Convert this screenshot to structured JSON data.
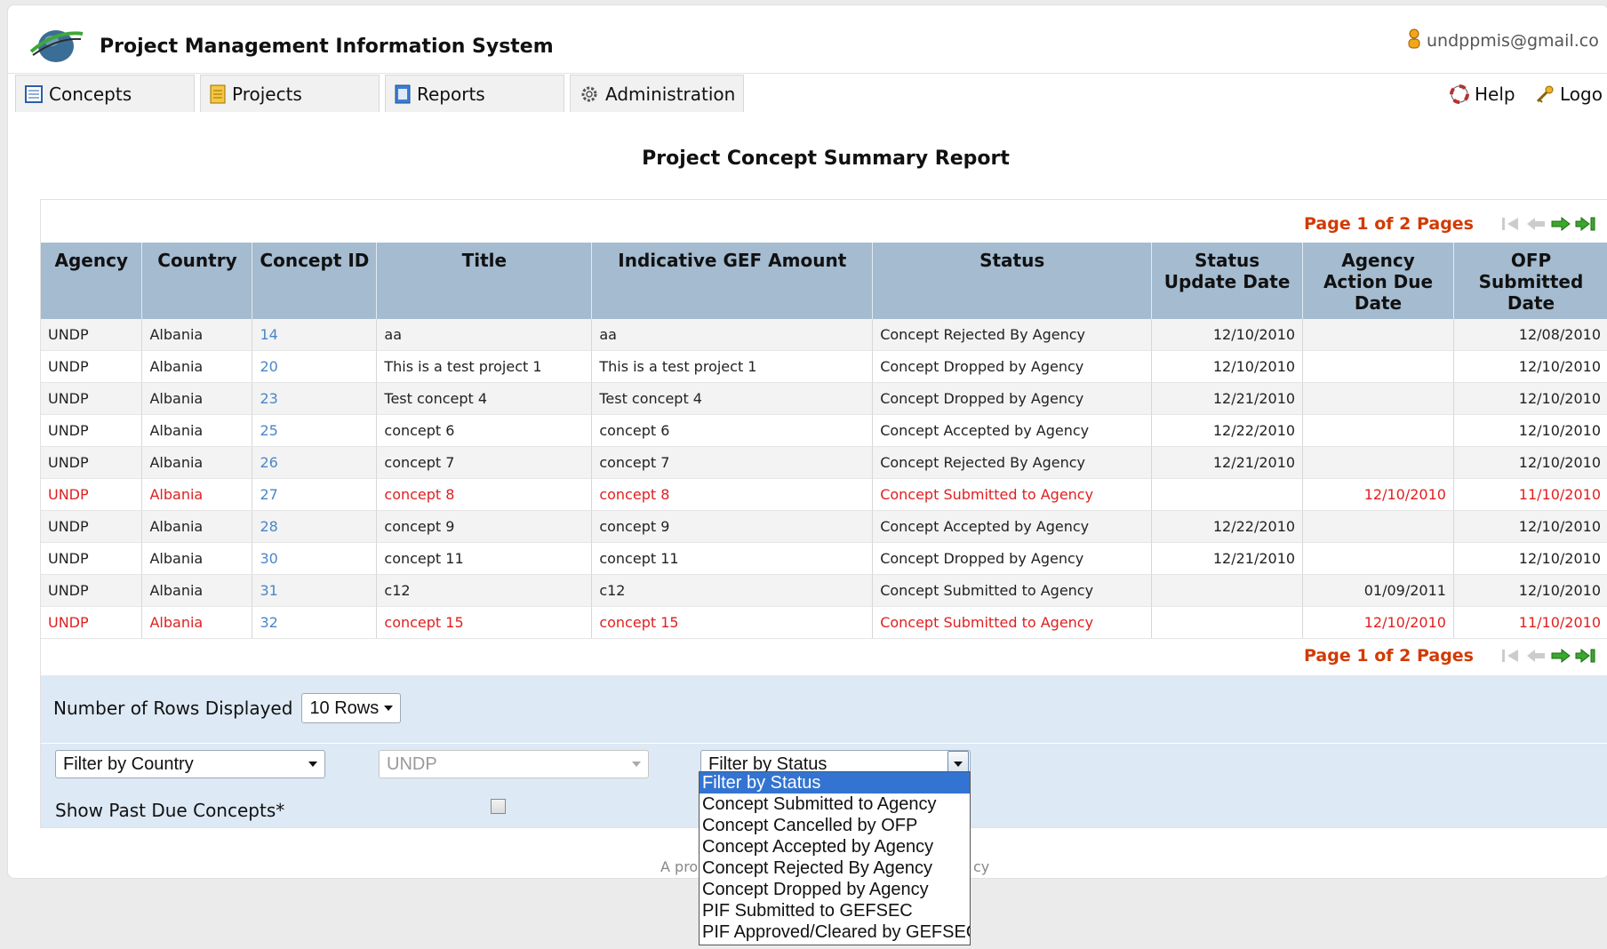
{
  "header": {
    "app_title": "Project Management Information System",
    "user_email": "undppmis@gmail.co"
  },
  "tabs": [
    {
      "label": "Concepts",
      "icon": "list-icon"
    },
    {
      "label": "Projects",
      "icon": "document-icon"
    },
    {
      "label": "Reports",
      "icon": "report-icon"
    },
    {
      "label": "Administration",
      "icon": "gear-icon"
    }
  ],
  "top_links": {
    "help": "Help",
    "logout": "Logo"
  },
  "report": {
    "title": "Project Concept Summary Report",
    "pager_text": "Page 1 of 2 Pages",
    "columns": [
      "Agency",
      "Country",
      "Concept ID",
      "Title",
      "Indicative GEF Amount",
      "Status",
      "Status Update Date",
      "Agency Action Due Date",
      "OFP Submitted Date"
    ],
    "rows": [
      {
        "agency": "UNDP",
        "country": "Albania",
        "id": "14",
        "title": "aa",
        "amount": "aa",
        "status": "Concept Rejected By Agency",
        "status_date": "12/10/2010",
        "due_date": "",
        "ofp_date": "12/08/2010",
        "overdue": false
      },
      {
        "agency": "UNDP",
        "country": "Albania",
        "id": "20",
        "title": "This is a test project 1",
        "amount": "This is a test project 1",
        "status": "Concept Dropped by Agency",
        "status_date": "12/10/2010",
        "due_date": "",
        "ofp_date": "12/10/2010",
        "overdue": false
      },
      {
        "agency": "UNDP",
        "country": "Albania",
        "id": "23",
        "title": "Test concept 4",
        "amount": "Test concept 4",
        "status": "Concept Dropped by Agency",
        "status_date": "12/21/2010",
        "due_date": "",
        "ofp_date": "12/10/2010",
        "overdue": false
      },
      {
        "agency": "UNDP",
        "country": "Albania",
        "id": "25",
        "title": "concept 6",
        "amount": "concept 6",
        "status": "Concept Accepted by Agency",
        "status_date": "12/22/2010",
        "due_date": "",
        "ofp_date": "12/10/2010",
        "overdue": false
      },
      {
        "agency": "UNDP",
        "country": "Albania",
        "id": "26",
        "title": "concept 7",
        "amount": "concept 7",
        "status": "Concept Rejected By Agency",
        "status_date": "12/21/2010",
        "due_date": "",
        "ofp_date": "12/10/2010",
        "overdue": false
      },
      {
        "agency": "UNDP",
        "country": "Albania",
        "id": "27",
        "title": "concept 8",
        "amount": "concept 8",
        "status": "Concept Submitted to Agency",
        "status_date": "",
        "due_date": "12/10/2010",
        "ofp_date": "11/10/2010",
        "overdue": true
      },
      {
        "agency": "UNDP",
        "country": "Albania",
        "id": "28",
        "title": "concept 9",
        "amount": "concept 9",
        "status": "Concept Accepted by Agency",
        "status_date": "12/22/2010",
        "due_date": "",
        "ofp_date": "12/10/2010",
        "overdue": false
      },
      {
        "agency": "UNDP",
        "country": "Albania",
        "id": "30",
        "title": "concept 11",
        "amount": "concept 11",
        "status": "Concept Dropped by Agency",
        "status_date": "12/21/2010",
        "due_date": "",
        "ofp_date": "12/10/2010",
        "overdue": false
      },
      {
        "agency": "UNDP",
        "country": "Albania",
        "id": "31",
        "title": "c12",
        "amount": "c12",
        "status": "Concept Submitted to Agency",
        "status_date": "",
        "due_date": "01/09/2011",
        "ofp_date": "12/10/2010",
        "overdue": false
      },
      {
        "agency": "UNDP",
        "country": "Albania",
        "id": "32",
        "title": "concept 15",
        "amount": "concept 15",
        "status": "Concept Submitted to Agency",
        "status_date": "",
        "due_date": "12/10/2010",
        "ofp_date": "11/10/2010",
        "overdue": true
      }
    ]
  },
  "controls": {
    "rows_label": "Number of Rows Displayed",
    "rows_value": "10 Rows",
    "country_filter": "Filter by Country",
    "agency_filter": "UNDP",
    "status_filter": "Filter by Status",
    "past_due_label": "Show Past Due Concepts*",
    "past_due_checked": false
  },
  "status_options": [
    "Filter by Status",
    "Concept Submitted to Agency",
    "Concept Cancelled by OFP",
    "Concept Accepted by Agency",
    "Concept Rejected By Agency",
    "Concept Dropped by Agency",
    "PIF Submitted to GEFSEC",
    "PIF Approved/Cleared by GEFSEC"
  ],
  "footer": {
    "left": "A prod",
    "right": "cy"
  },
  "colors": {
    "header_bg": "#a4bbd0",
    "overdue": "#e02020",
    "pager": "#d23a00",
    "link": "#4a86c8",
    "filter_bg": "#dde9f4",
    "selected_option": "#3374d2"
  }
}
